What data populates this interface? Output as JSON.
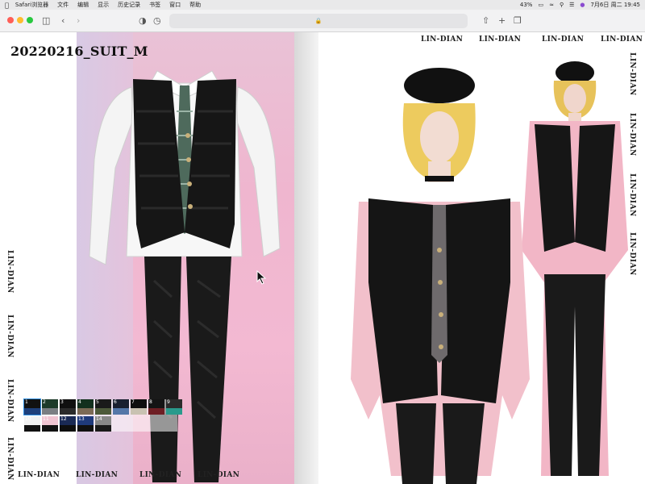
{
  "menubar": {
    "app": "Safari浏览器",
    "items": [
      "文件",
      "编辑",
      "显示",
      "历史记录",
      "书签",
      "窗口",
      "帮助"
    ],
    "battery": "43%",
    "datetime": "7月6日 周二 19:45",
    "icons": [
      "apple-icon",
      "battery-icon",
      "wifi-icon",
      "search-icon",
      "control-center-icon",
      "siri-icon"
    ]
  },
  "toolbar": {
    "icons": [
      "sidebar-icon",
      "back-icon",
      "forward-icon",
      "shield-icon",
      "history-icon",
      "lock-icon",
      "share-icon",
      "new-tab-icon",
      "tabs-overview-icon"
    ]
  },
  "page": {
    "title": "20220216_SUIT_M",
    "watermark": "LIN-DIAN"
  },
  "swatches": [
    {
      "n": "1",
      "top": "#111111",
      "bot": "#1e3f7a",
      "selected": true
    },
    {
      "n": "2",
      "top": "#1d3b2a",
      "bot": "#7a7f83"
    },
    {
      "n": "3",
      "top": "#101010",
      "bot": "#2b2b2b"
    },
    {
      "n": "4",
      "top": "#13301e",
      "bot": "#7c6a55"
    },
    {
      "n": "5",
      "top": "#1a1a1a",
      "bot": "#4d5a3a"
    },
    {
      "n": "6",
      "top": "#1a2030",
      "bot": "#5477a8"
    },
    {
      "n": "7",
      "top": "#0f0f0f",
      "bot": "#c9c2b2"
    },
    {
      "n": "8",
      "top": "#141414",
      "bot": "#6e1f24"
    },
    {
      "n": "9",
      "top": "#2b2b2b",
      "bot": "#2a9a8c"
    },
    {
      "n": "10",
      "top": "#f1f1f1",
      "bot": "#111111"
    },
    {
      "n": "11",
      "top": "#f0c5d2",
      "bot": "#121212"
    },
    {
      "n": "12",
      "top": "#1a2a55",
      "bot": "#0e0e0e"
    },
    {
      "n": "13",
      "top": "#1f3a7b",
      "bot": "#101010"
    },
    {
      "n": "14",
      "top": "#888888",
      "bot": "#191919"
    }
  ]
}
